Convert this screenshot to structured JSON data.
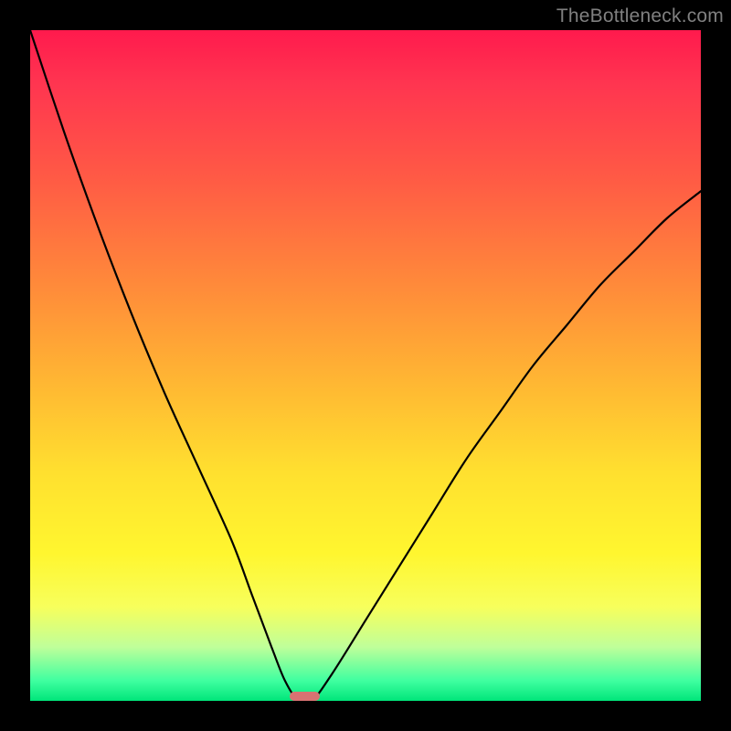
{
  "watermark": "TheBottleneck.com",
  "chart_data": {
    "type": "line",
    "title": "",
    "xlabel": "",
    "ylabel": "",
    "xlim": [
      0,
      100
    ],
    "ylim": [
      0,
      100
    ],
    "grid": false,
    "series": [
      {
        "name": "curve",
        "x": [
          0,
          5,
          10,
          15,
          20,
          25,
          30,
          33,
          36,
          38,
          40,
          42,
          45,
          50,
          55,
          60,
          65,
          70,
          75,
          80,
          85,
          90,
          95,
          100
        ],
        "y": [
          100,
          85,
          71,
          58,
          46,
          35,
          24,
          16,
          8,
          3,
          0,
          0,
          4,
          12,
          20,
          28,
          36,
          43,
          50,
          56,
          62,
          67,
          72,
          76
        ]
      }
    ],
    "marker": {
      "x_center_pct": 41,
      "width_pct": 4.5,
      "height_pct": 1.3
    },
    "gradient_stops": [
      {
        "pct": 0,
        "color": "#ff1a4d"
      },
      {
        "pct": 22,
        "color": "#ff5a45"
      },
      {
        "pct": 52,
        "color": "#ffb533"
      },
      {
        "pct": 78,
        "color": "#fff62f"
      },
      {
        "pct": 100,
        "color": "#00e57a"
      }
    ]
  }
}
